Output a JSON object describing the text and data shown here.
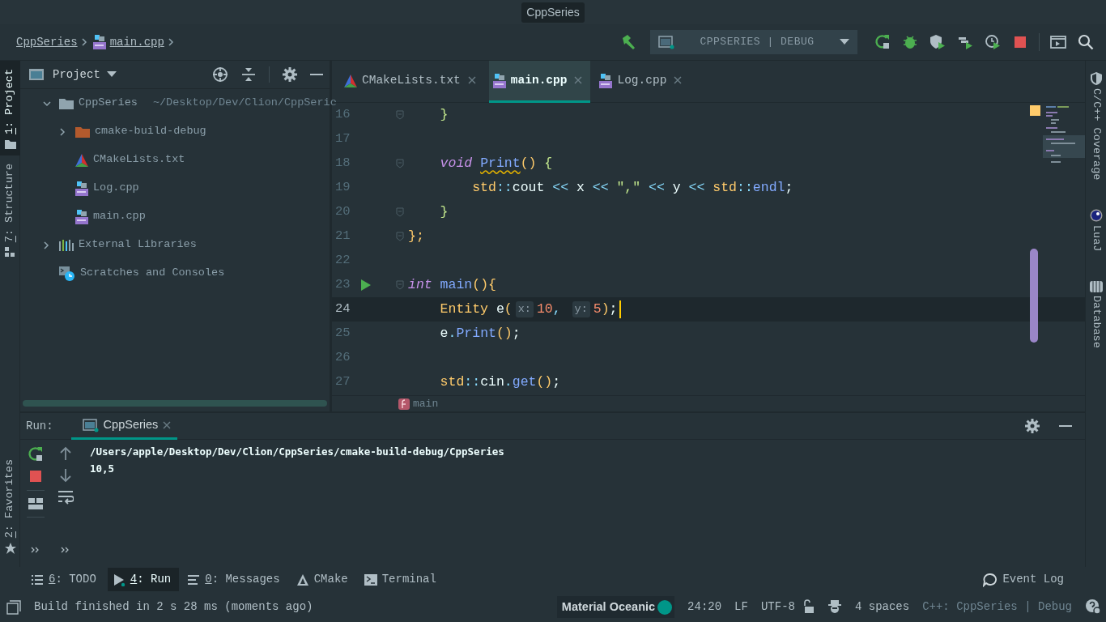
{
  "title": "CppSeries",
  "breadcrumb": [
    {
      "label": "CppSeries",
      "kind": "project"
    },
    {
      "label": "main.cpp",
      "kind": "cpp"
    }
  ],
  "run_config": "CPPSERIES | DEBUG",
  "left_stripe": [
    {
      "label": "1: Project",
      "kind": "folder",
      "selected": true,
      "mnemonic": true
    },
    {
      "label": "7: Structure",
      "kind": "structure",
      "selected": false,
      "mnemonic": true
    }
  ],
  "left_stripe_bottom": [
    {
      "label": "2: Favorites",
      "kind": "star",
      "selected": false,
      "mnemonic": true
    }
  ],
  "project_panel": {
    "title": "Project",
    "tree": [
      {
        "label": "CppSeries",
        "kind": "folder",
        "path": "~/Desktop/Dev/Clion/CppSerie",
        "expanded": true,
        "children": [
          {
            "label": "cmake-build-debug",
            "kind": "build_folder",
            "expanded": false
          },
          {
            "label": "CMakeLists.txt",
            "kind": "cmake"
          },
          {
            "label": "Log.cpp",
            "kind": "cpp"
          },
          {
            "label": "main.cpp",
            "kind": "cpp"
          }
        ]
      },
      {
        "label": "External Libraries",
        "kind": "libraries",
        "expanded": false
      },
      {
        "label": "Scratches and Consoles",
        "kind": "scratches"
      }
    ]
  },
  "editor": {
    "tabs": [
      {
        "label": "CMakeLists.txt",
        "kind": "cmake",
        "selected": false
      },
      {
        "label": "main.cpp",
        "kind": "cpp",
        "selected": true
      },
      {
        "label": "Log.cpp",
        "kind": "cpp",
        "selected": false
      }
    ],
    "lines": [
      {
        "number": "16",
        "current": false,
        "run_marker": false,
        "foldable": true,
        "tokens": [
          {
            "text": "    }",
            "kind": "inner_brace"
          }
        ]
      },
      {
        "number": "17",
        "current": false,
        "run_marker": false,
        "foldable": false
      },
      {
        "number": "18",
        "current": false,
        "run_marker": false,
        "foldable": true,
        "tokens": [
          {
            "text": "    void ",
            "kind": "keyword"
          },
          {
            "text": "Print",
            "kind": "function",
            "warning": true
          },
          {
            "text": "()",
            "kind": "brace"
          },
          {
            "text": " {",
            "kind": "inner_brace"
          }
        ]
      },
      {
        "number": "19",
        "current": false,
        "run_marker": false,
        "foldable": false,
        "tokens": [
          {
            "text": "        std",
            "kind": "type"
          },
          {
            "text": "::",
            "kind": "op"
          },
          {
            "text": "cout",
            "kind": "plain"
          },
          {
            "text": " << ",
            "kind": "op"
          },
          {
            "text": "x",
            "kind": "plain"
          },
          {
            "text": " << ",
            "kind": "op"
          },
          {
            "text": "\",\"",
            "kind": "string"
          },
          {
            "text": " << ",
            "kind": "op"
          },
          {
            "text": "y",
            "kind": "plain"
          },
          {
            "text": " << ",
            "kind": "op"
          },
          {
            "text": "std",
            "kind": "type"
          },
          {
            "text": "::",
            "kind": "op"
          },
          {
            "text": "endl",
            "kind": "function"
          },
          {
            "text": ";",
            "kind": "plain"
          }
        ]
      },
      {
        "number": "20",
        "current": false,
        "run_marker": false,
        "foldable": true,
        "tokens": [
          {
            "text": "    }",
            "kind": "inner_brace"
          }
        ]
      },
      {
        "number": "21",
        "current": false,
        "run_marker": false,
        "foldable": true,
        "tokens": [
          {
            "text": "};",
            "kind": "brace"
          }
        ]
      },
      {
        "number": "22",
        "current": false,
        "run_marker": false,
        "foldable": false
      },
      {
        "number": "23",
        "current": false,
        "run_marker": true,
        "foldable": true,
        "tokens": [
          {
            "text": "int",
            "kind": "keyword"
          },
          {
            "text": " main",
            "kind": "function"
          },
          {
            "text": "(){",
            "kind": "brace"
          }
        ]
      },
      {
        "number": "24",
        "current": true,
        "run_marker": false,
        "foldable": false,
        "tokens": [
          {
            "text": "    Entity",
            "kind": "type"
          },
          {
            "text": " e",
            "kind": "plain"
          },
          {
            "text": "(",
            "kind": "brace"
          },
          {
            "text": "x:",
            "kind": "hint"
          },
          {
            "text": "10",
            "kind": "number"
          },
          {
            "text": ", ",
            "kind": "op"
          },
          {
            "text": "y:",
            "kind": "hint"
          },
          {
            "text": "5",
            "kind": "number"
          },
          {
            "text": ")",
            "kind": "brace"
          },
          {
            "text": ";",
            "kind": "plain"
          }
        ]
      },
      {
        "number": "25",
        "current": false,
        "run_marker": false,
        "foldable": false,
        "tokens": [
          {
            "text": "    e",
            "kind": "plain"
          },
          {
            "text": ".",
            "kind": "op"
          },
          {
            "text": "Print",
            "kind": "function"
          },
          {
            "text": "()",
            "kind": "brace"
          },
          {
            "text": ";",
            "kind": "plain"
          }
        ]
      },
      {
        "number": "26",
        "current": false,
        "run_marker": false,
        "foldable": false
      },
      {
        "number": "27",
        "current": false,
        "run_marker": false,
        "foldable": false,
        "tokens": [
          {
            "text": "    std",
            "kind": "type"
          },
          {
            "text": "::",
            "kind": "op"
          },
          {
            "text": "cin",
            "kind": "plain"
          },
          {
            "text": ".",
            "kind": "op"
          },
          {
            "text": "get",
            "kind": "function"
          },
          {
            "text": "()",
            "kind": "brace"
          },
          {
            "text": ";",
            "kind": "plain"
          }
        ]
      }
    ],
    "breadcrumb": "main"
  },
  "right_stripe": [
    {
      "label": "C/C++ Coverage",
      "kind": "shield"
    },
    {
      "label": "LuaJ",
      "kind": "luaj"
    },
    {
      "label": "Database",
      "kind": "database"
    }
  ],
  "run_panel": {
    "title": "Run:",
    "tabs": [
      {
        "label": "CppSeries",
        "selected": true
      }
    ],
    "output": [
      "/Users/apple/Desktop/Dev/Clion/CppSeries/cmake-build-debug/CppSeries",
      "10,5"
    ]
  },
  "tool_windows": [
    {
      "label": "6: TODO",
      "kind": "todo",
      "selected": false,
      "mnemonic": true
    },
    {
      "label": "4: Run",
      "kind": "run",
      "selected": true,
      "mnemonic": true
    },
    {
      "label": "0: Messages",
      "kind": "messages",
      "selected": false,
      "mnemonic": true
    },
    {
      "label": "CMake",
      "kind": "cmake",
      "selected": false,
      "mnemonic": false
    },
    {
      "label": "Terminal",
      "kind": "terminal",
      "selected": false,
      "mnemonic": false
    }
  ],
  "event_log": "Event Log",
  "status_bar": {
    "message": "Build finished in 2 s 28 ms (moments ago)",
    "theme": "Material Oceanic",
    "position": "24:20",
    "line_separator": "LF",
    "encoding": "UTF-8",
    "indent": "4 spaces",
    "context": "C++: CppSeries | Debug"
  }
}
